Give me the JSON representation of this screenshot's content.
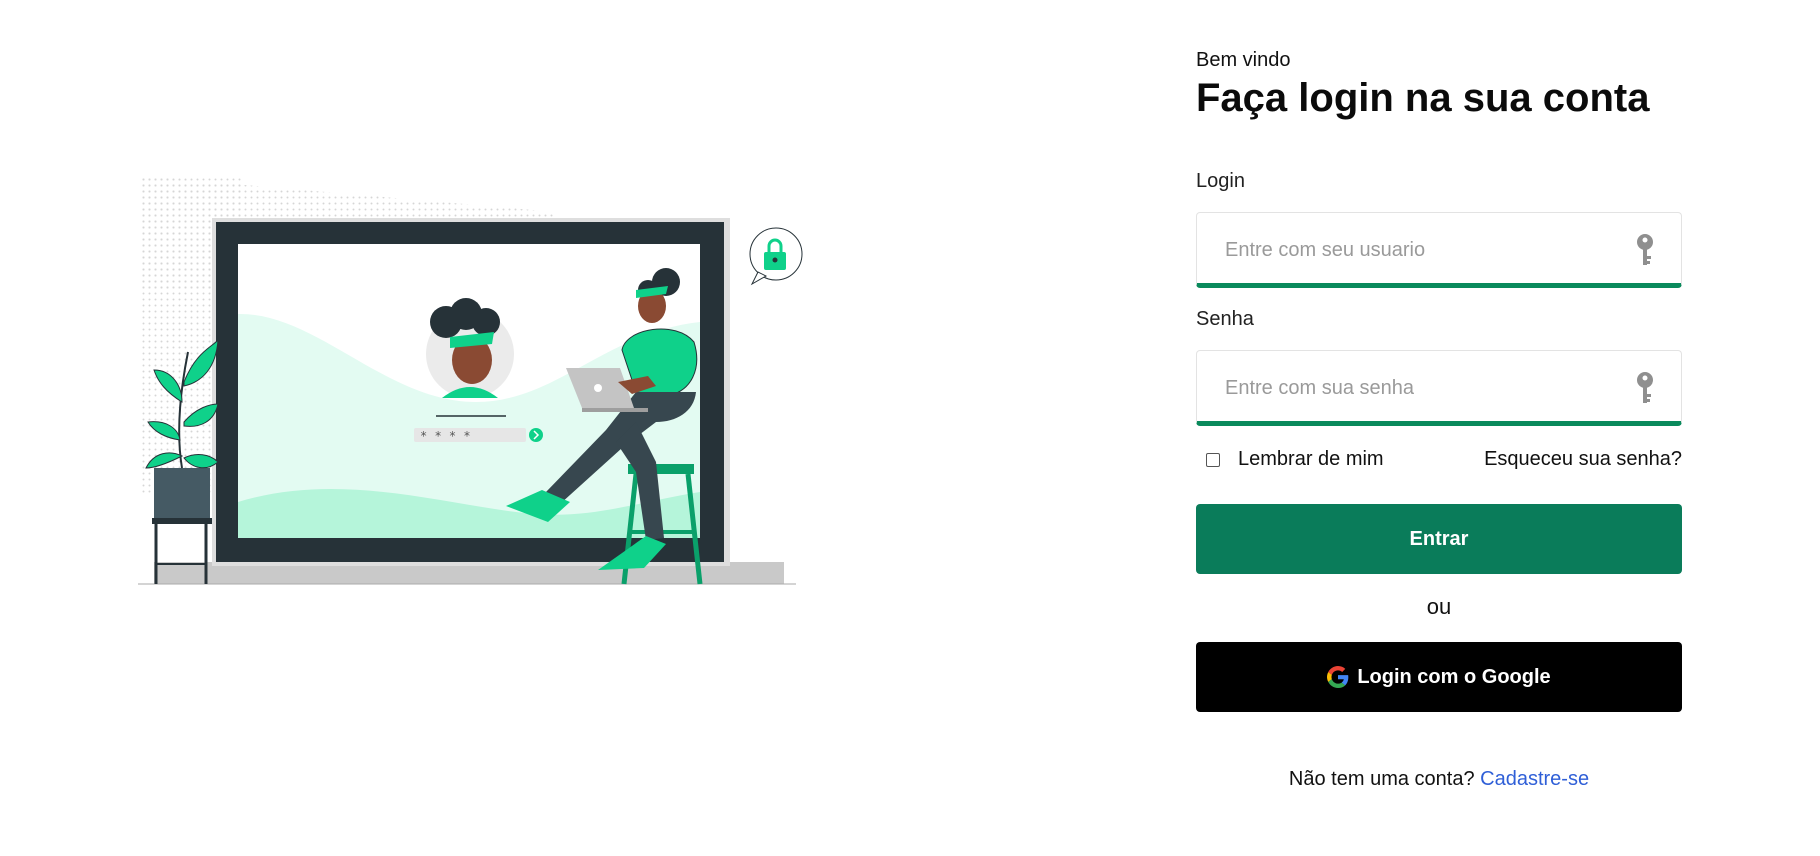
{
  "header": {
    "welcome": "Bem vindo",
    "title": "Faça login na sua conta"
  },
  "login": {
    "label": "Login",
    "placeholder": "Entre com seu usuario",
    "value": ""
  },
  "password": {
    "label": "Senha",
    "placeholder": "Entre com sua senha",
    "value": ""
  },
  "remember": {
    "label": "Lembrar de mim",
    "checked": false
  },
  "forgot_link": "Esqueceu sua senha?",
  "submit_label": "Entrar",
  "separator": "ou",
  "google_label": "Login com o Google",
  "signup": {
    "prompt": "Não tem uma conta?",
    "link": "Cadastre-se"
  },
  "illustration": {
    "password_mask": "* * * *"
  },
  "colors": {
    "accent": "#0a7c5a",
    "accent_bright": "#0fd18a",
    "link": "#2f5fd7",
    "dark": "#263238"
  },
  "icons": {
    "field": "key-icon",
    "google": "google-icon",
    "lock": "lock-icon"
  }
}
